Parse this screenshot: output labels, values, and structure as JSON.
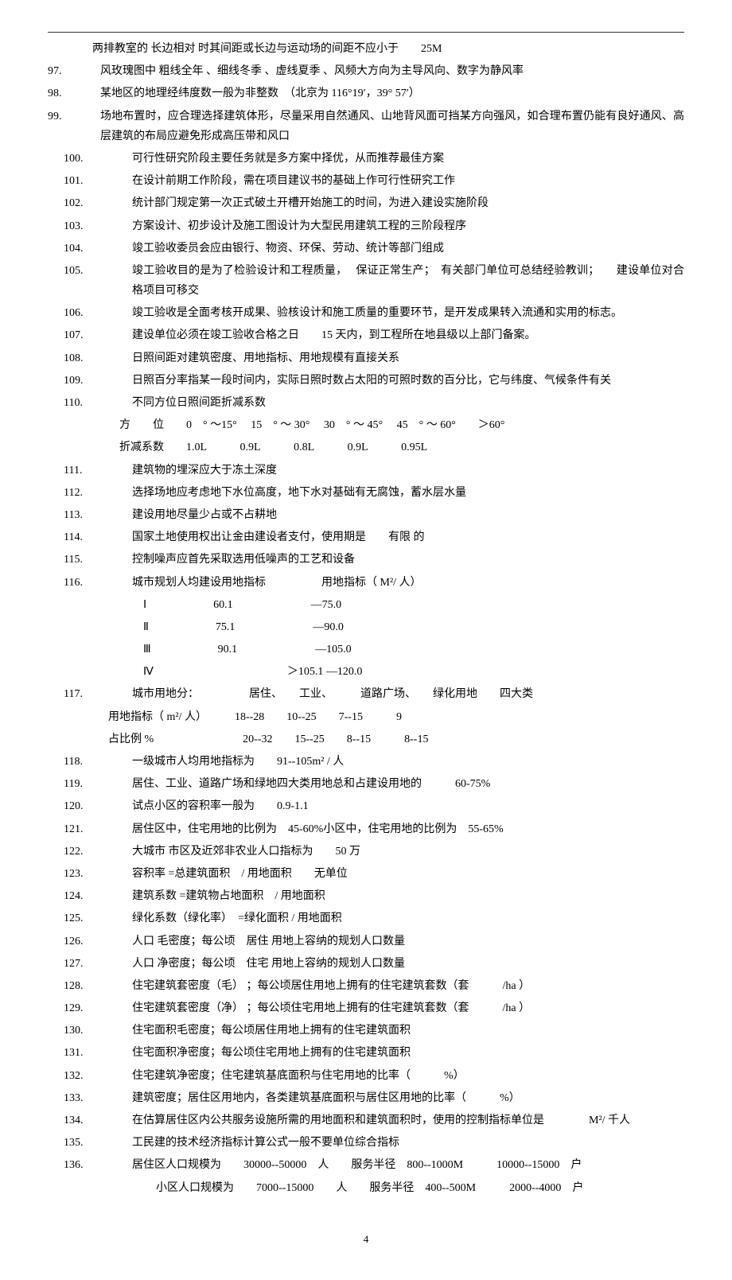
{
  "page_number": "4",
  "items": [
    {
      "type": "cont",
      "text": "两排教室的 长边相对 时其间距或长边与运动场的间距不应小于　　25M"
    },
    {
      "type": "item",
      "no": "97.",
      "text": "风玫瑰图中 粗线全年 、细线冬季 、虚线夏季 、风频大方向为主导风向、数字为静风率"
    },
    {
      "type": "item",
      "no": "98.",
      "text": "某地区的地理经纬度数一般为非整数　（北京为 116°19′，39° 57′）"
    },
    {
      "type": "item",
      "no": "99.",
      "text": "场地布置时，应合理选择建筑体形，尽量采用自然通风、山地背风面可挡某方向强风，如合理布置仍能有良好通风、高层建筑的布局应避免形成高压带和风口"
    },
    {
      "type": "item2",
      "no": "100.",
      "text": "可行性研究阶段主要任务就是多方案中择优，从而推荐最佳方案"
    },
    {
      "type": "item2",
      "no": "101.",
      "text": "在设计前期工作阶段，需在项目建议书的基础上作可行性研究工作"
    },
    {
      "type": "item2",
      "no": "102.",
      "text": "统计部门规定第一次正式破土开槽开始施工的时间，为进入建设实施阶段"
    },
    {
      "type": "item2",
      "no": "103.",
      "text": "方案设计、初步设计及施工图设计为大型民用建筑工程的三阶段程序"
    },
    {
      "type": "item2",
      "no": "104.",
      "text": "竣工验收委员会应由银行、物资、环保、劳动、统计等部门组成"
    },
    {
      "type": "item2",
      "no": "105.",
      "text": "竣工验收目的是为了检验设计和工程质量，　 保证正常生产；　有关部门单位可总结经验教训；　　建设单位对合格项目可移交"
    },
    {
      "type": "item2",
      "no": "106.",
      "text": "竣工验收是全面考核开成果、验核设计和施工质量的重要环节，是开发成果转入流通和实用的标志。"
    },
    {
      "type": "item2",
      "no": "107.",
      "text": "建设单位必须在竣工验收合格之日　　15 天内，到工程所在地县级以上部门备案。"
    },
    {
      "type": "item2",
      "no": "108.",
      "text": "日照间距对建筑密度、用地指标、用地规模有直接关系"
    },
    {
      "type": "item2",
      "no": "109.",
      "text": "日照百分率指某一段时间内，实际日照时数占太阳的可照时数的百分比，它与纬度、气候条件有关"
    },
    {
      "type": "item2",
      "no": "110.",
      "text": "不同方位日照间距折减系数"
    },
    {
      "type": "table",
      "text": "方　　位　　0　° ～15°　 15　° ～ 30°　 30　° ～ 45°　 45　° ～ 60°　　＞60°"
    },
    {
      "type": "table",
      "text": "折减系数　　1.0L　　　0.9L　　　0.8L　　　0.9L　　　0.95L"
    },
    {
      "type": "item2",
      "no": "111.",
      "text": "建筑物的埋深应大于冻土深度"
    },
    {
      "type": "item2",
      "no": "112.",
      "text": "选择场地应考虑地下水位高度，地下水对基础有无腐蚀，蓄水层水量"
    },
    {
      "type": "item2",
      "no": "113.",
      "text": "建设用地尽量少占或不占耕地"
    },
    {
      "type": "item2",
      "no": "114.",
      "text": "国家土地使用权出让金由建设者支付，使用期是　　有限 的"
    },
    {
      "type": "item2",
      "no": "115.",
      "text": "控制噪声应首先采取选用低噪声的工艺和设备"
    },
    {
      "type": "item2",
      "no": "116.",
      "text": "城市规划人均建设用地指标　　　　　用地指标（ M²/ 人）"
    },
    {
      "type": "table2",
      "text": "Ⅰ　　　　　　60.1　　　　　　　—75.0"
    },
    {
      "type": "table2",
      "text": "Ⅱ　　　　　　75.1　　　　　　　—90.0"
    },
    {
      "type": "table2",
      "text": "Ⅲ　　　　　　90.1　　　　　　　—105.0"
    },
    {
      "type": "table2",
      "text": "Ⅳ　　　　　　　　　　　　＞105.1 —120.0"
    },
    {
      "type": "item2",
      "no": "117.",
      "text": "城市用地分：　　　　　居住、　　工业、　　　道路广场、　　绿化用地　　四大类"
    },
    {
      "type": "cont2",
      "text": "用地指标（ m²/ 人）　　　18--28　　10--25　　7--15　　　9"
    },
    {
      "type": "cont2",
      "text": "占比例 %　　　　　　　　20--32　　15--25　　8--15　　　8--15"
    },
    {
      "type": "item2",
      "no": "118.",
      "text": "一级城市人均用地指标为　　91--105m² / 人"
    },
    {
      "type": "item2",
      "no": "119.",
      "text": "居住、工业、道路广场和绿地四大类用地总和占建设用地的　　　60-75%"
    },
    {
      "type": "item2",
      "no": "120.",
      "text": "试点小区的容积率一般为　　0.9-1.1"
    },
    {
      "type": "item2",
      "no": "121.",
      "text": "居住区中，住宅用地的比例为　45-60%小区中，住宅用地的比例为　55-65%"
    },
    {
      "type": "item2",
      "no": "122.",
      "text": "大城市 市区及近郊非农业人口指标为　　50 万"
    },
    {
      "type": "item2",
      "no": "123.",
      "text": "容积率 =总建筑面积　/ 用地面积　　无单位"
    },
    {
      "type": "item2",
      "no": "124.",
      "text": "建筑系数 =建筑物占地面积　/ 用地面积"
    },
    {
      "type": "item2",
      "no": "125.",
      "text": "绿化系数（绿化率）　=绿化面积 / 用地面积"
    },
    {
      "type": "item2",
      "no": "126.",
      "text": "人口 毛密度；每公顷　居住 用地上容纳的规划人口数量"
    },
    {
      "type": "item2",
      "no": "127.",
      "text": "人口 净密度；每公顷　住宅 用地上容纳的规划人口数量"
    },
    {
      "type": "item2",
      "no": "128.",
      "text": "住宅建筑套密度（毛） ；每公顷居住用地上拥有的住宅建筑套数（套　　　/ha ）"
    },
    {
      "type": "item2",
      "no": "129.",
      "text": "住宅建筑套密度（净） ；每公顷住宅用地上拥有的住宅建筑套数（套　　　/ha ）"
    },
    {
      "type": "item2",
      "no": "130.",
      "text": "住宅面积毛密度；每公顷居住用地上拥有的住宅建筑面积"
    },
    {
      "type": "item2",
      "no": "131.",
      "text": "住宅面积净密度；每公顷住宅用地上拥有的住宅建筑面积"
    },
    {
      "type": "item2",
      "no": "132.",
      "text": "住宅建筑净密度；住宅建筑基底面积与住宅用地的比率（　　　%）"
    },
    {
      "type": "item2",
      "no": "133.",
      "text": "建筑密度；居住区用地内，各类建筑基底面积与居住区用地的比率（　　　%）"
    },
    {
      "type": "item2",
      "no": "134.",
      "text": "在估算居住区内公共服务设施所需的用地面积和建筑面积时，使用的控制指标单位是　　　　M²/ 千人"
    },
    {
      "type": "item2",
      "no": "135.",
      "text": "工民建的技术经济指标计算公式一般不要单位综合指标"
    },
    {
      "type": "item2",
      "no": "136.",
      "text": "居住区人口规模为　　30000--50000　人　　服务半径　800--1000M　　　10000--15000　户"
    },
    {
      "type": "cont3",
      "text": "小区人口规模为　　7000--15000　　人　　服务半径　400--500M　　　2000--4000　户"
    }
  ]
}
